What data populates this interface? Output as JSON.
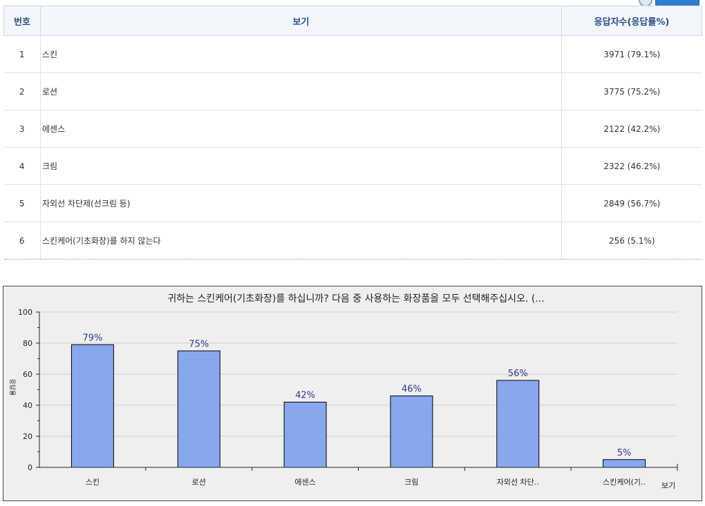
{
  "table": {
    "headers": {
      "num": "번호",
      "option": "보기",
      "count": "응답자수(응답률%)"
    },
    "rows": [
      {
        "num": "1",
        "option": "스킨",
        "count": "3971 (79.1%)"
      },
      {
        "num": "2",
        "option": "로션",
        "count": "3775 (75.2%)"
      },
      {
        "num": "3",
        "option": "에센스",
        "count": "2122 (42.2%)"
      },
      {
        "num": "4",
        "option": "크림",
        "count": "2322 (46.2%)"
      },
      {
        "num": "5",
        "option": "자외선 차단제(선크림 등)",
        "count": "2849 (56.7%)"
      },
      {
        "num": "6",
        "option": "스킨케어(기초화장)를 하지 않는다",
        "count": "256 (5.1%)"
      }
    ]
  },
  "chart_data": {
    "type": "bar",
    "title": "귀하는 스킨케어(기초화장)를 하십니까? 다음 중 사용하는 화장품을 모두 선택해주십시오. (...",
    "xlabel": "보기",
    "ylabel": "응답율",
    "categories": [
      "스킨",
      "로션",
      "에센스",
      "크림",
      "자외선 차단..",
      "스킨케어(기.."
    ],
    "values": [
      79,
      75,
      42,
      46,
      56,
      5
    ],
    "data_labels": [
      "79%",
      "75%",
      "42%",
      "46%",
      "56%",
      "5%"
    ],
    "ylim": [
      0,
      100
    ],
    "yticks": [
      0,
      20,
      40,
      60,
      80,
      100
    ],
    "grid": true,
    "bar_color": "#87a8ef",
    "bar_border": "#000000"
  }
}
